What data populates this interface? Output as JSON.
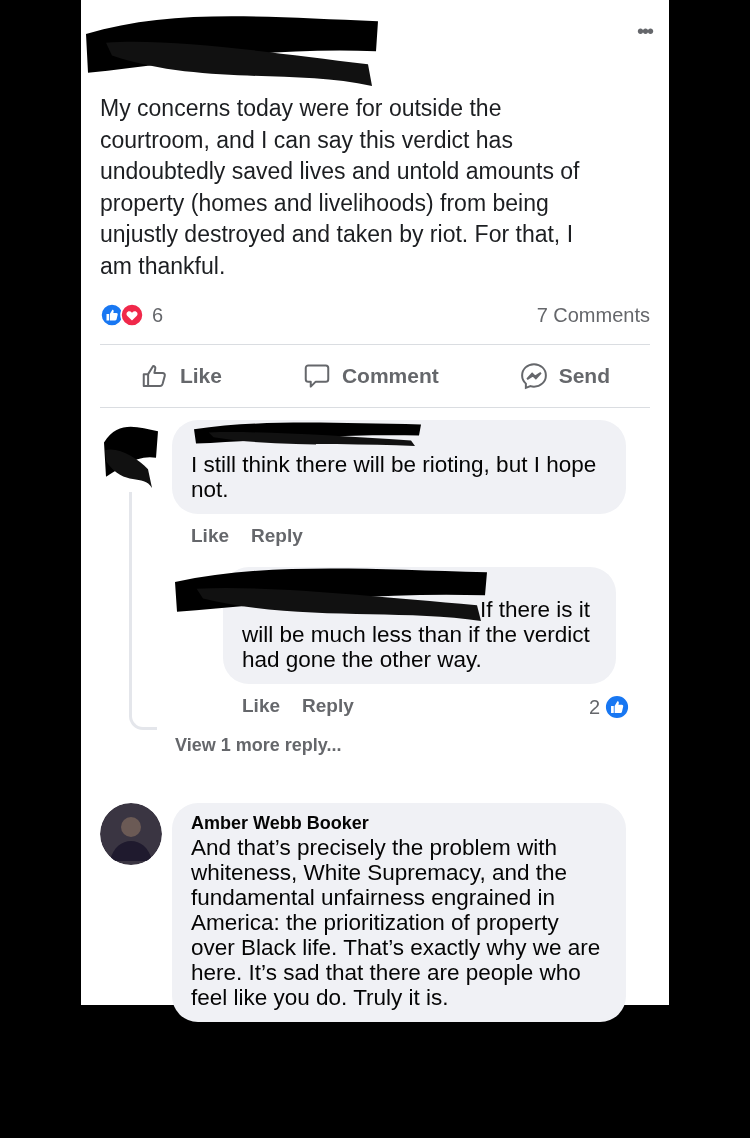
{
  "post": {
    "redacted": true,
    "menu": "•••",
    "body": "My concerns today were for outside the courtroom, and I can say this verdict has undoubtedly saved lives and untold amounts of property (homes and livelihoods) from being unjustly destroyed and taken by riot. For that, I am thankful.",
    "reaction_count": "6",
    "comments_count": "7 Comments",
    "actions": [
      {
        "kind": "like",
        "label": "Like"
      },
      {
        "kind": "comment",
        "label": "Comment"
      },
      {
        "kind": "send",
        "label": "Send"
      }
    ]
  },
  "threads": [
    {
      "redacted": true,
      "text": "I still think there will be rioting, but I hope not.",
      "actions": [
        "Like",
        "Reply"
      ],
      "replies": [
        {
          "redacted": true,
          "text": "If there is it will be much less than if the verdict had gone the other way.",
          "actions": [
            "Like",
            "Reply"
          ],
          "likes": "2"
        }
      ],
      "view_more": "View 1 more reply..."
    },
    {
      "redacted": false,
      "name": "Amber Webb Booker",
      "text": "And that’s precisely the problem with whiteness, White Supremacy, and the fundamental unfairness engrained in America: the prioritization of property over Black life. That’s exactly why we are here. It’s sad that there are people who feel like you do. Truly it is."
    }
  ]
}
